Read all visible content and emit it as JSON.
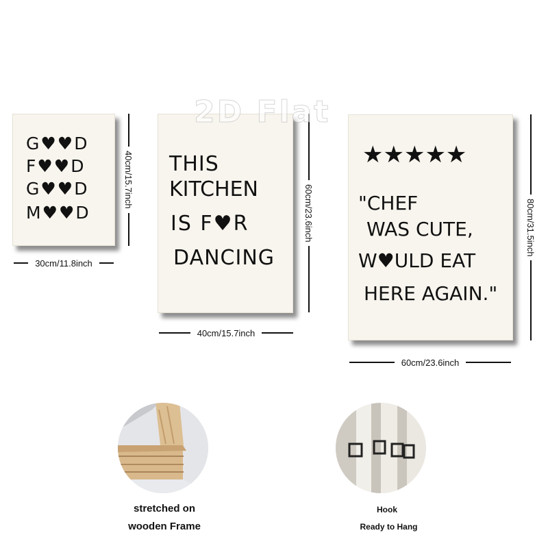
{
  "watermark": "2D Flat",
  "posters": {
    "small": {
      "lines": [
        "G♥♥D",
        "F♥♥D",
        "G♥♥D",
        "M♥♥D"
      ],
      "width_label": "30cm/11.8inch",
      "height_label": "40cm/15.7inch"
    },
    "medium": {
      "lines": [
        "THIS",
        "KITCHEN",
        "IS F♥R",
        "DANCING"
      ],
      "width_label": "40cm/15.7inch",
      "height_label": "60cm/23.6inch"
    },
    "large": {
      "stars": "★★★★★",
      "lines": [
        "\"CHEF",
        "WAS CUTE,",
        "W♥ULD EAT",
        "HERE AGAIN.\""
      ],
      "width_label": "60cm/23.6inch",
      "height_label": "80cm/31.5inch"
    }
  },
  "details": {
    "frame_caption": "stretched on wooden Frame",
    "hook_caption": "Hook",
    "hang_caption": "Ready to Hang"
  }
}
